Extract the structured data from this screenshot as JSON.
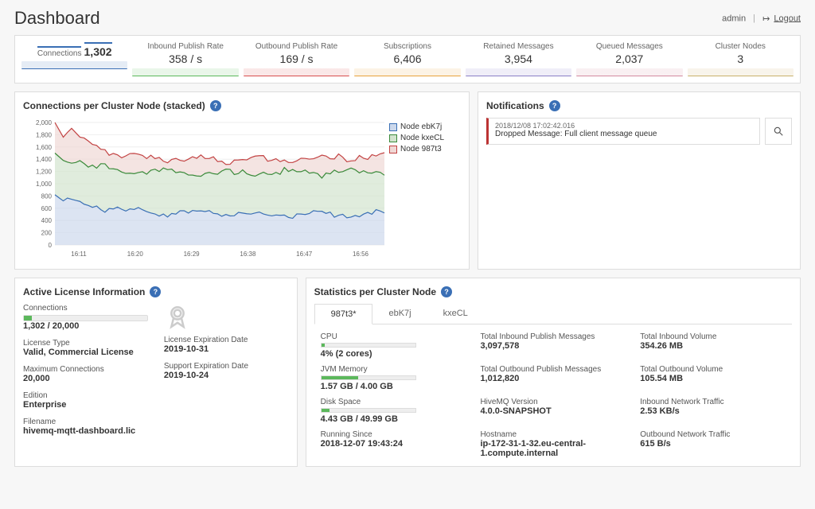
{
  "header": {
    "title": "Dashboard",
    "user": "admin",
    "logout": "Logout"
  },
  "kpis": [
    {
      "label": "Connections",
      "value": "1,302",
      "color": "#3a6fb5",
      "active": true
    },
    {
      "label": "Inbound Publish Rate",
      "value": "358 / s",
      "color": "#5cb85c"
    },
    {
      "label": "Outbound Publish Rate",
      "value": "169 / s",
      "color": "#d94e4e"
    },
    {
      "label": "Subscriptions",
      "value": "6,406",
      "color": "#e8a33d"
    },
    {
      "label": "Retained Messages",
      "value": "3,954",
      "color": "#8a7fc7"
    },
    {
      "label": "Queued Messages",
      "value": "2,037",
      "color": "#d48aa0"
    },
    {
      "label": "Cluster Nodes",
      "value": "3",
      "color": "#c9b06a"
    }
  ],
  "chart": {
    "title": "Connections per Cluster Node (stacked)",
    "yaxis": {
      "min": 0,
      "max": 2000,
      "step": 200,
      "labels": [
        "0",
        "200",
        "400",
        "600",
        "800",
        "1,000",
        "1,200",
        "1,400",
        "1,600",
        "1,800",
        "2,000"
      ]
    },
    "xaxis": [
      "16:11",
      "16:20",
      "16:29",
      "16:38",
      "16:47",
      "16:56"
    ],
    "legend": [
      {
        "name": "Node ebK7j",
        "color": "#3a6fb5",
        "fill": "#cdd9ec"
      },
      {
        "name": "Node kxeCL",
        "color": "#3a8a3a",
        "fill": "#d3e4ce"
      },
      {
        "name": "Node 987t3",
        "color": "#c24242",
        "fill": "#f0d8d5"
      }
    ]
  },
  "chart_data": {
    "type": "area",
    "title": "Connections per Cluster Node (stacked)",
    "xlabel": "",
    "ylabel": "",
    "ylim": [
      0,
      2000
    ],
    "x": [
      "16:11",
      "16:20",
      "16:29",
      "16:38",
      "16:47",
      "16:56"
    ],
    "series": [
      {
        "name": "Node ebK7j",
        "color": "#3a6fb5",
        "values_cumulative": [
          800,
          600,
          580,
          560,
          570,
          560
        ],
        "note": "bottom band top edge ≈ value"
      },
      {
        "name": "Node kxeCL",
        "color": "#3a8a3a",
        "values_cumulative": [
          1500,
          1250,
          1230,
          1220,
          1230,
          1250
        ]
      },
      {
        "name": "Node 987t3",
        "color": "#c24242",
        "values_cumulative": [
          2000,
          1500,
          1450,
          1430,
          1440,
          1500
        ]
      }
    ]
  },
  "notifications": {
    "title": "Notifications",
    "items": [
      {
        "ts": "2018/12/08 17:02:42.016",
        "msg": "Dropped Message: Full client message queue"
      }
    ]
  },
  "license": {
    "title": "Active License Information",
    "connections": {
      "label": "Connections",
      "value": "1,302 / 20,000",
      "pct": 6.5
    },
    "type": {
      "label": "License Type",
      "value": "Valid, Commercial License"
    },
    "max": {
      "label": "Maximum Connections",
      "value": "20,000"
    },
    "edition": {
      "label": "Edition",
      "value": "Enterprise"
    },
    "filename": {
      "label": "Filename",
      "value": "hivemq-mqtt-dashboard.lic"
    },
    "exp": {
      "label": "License Expiration Date",
      "value": "2019-10-31"
    },
    "support": {
      "label": "Support Expiration Date",
      "value": "2019-10-24"
    }
  },
  "stats": {
    "title": "Statistics per Cluster Node",
    "tabs": [
      "987t3*",
      "ebK7j",
      "kxeCL"
    ],
    "activeTab": 0,
    "cpu": {
      "label": "CPU",
      "value": "4% (2 cores)",
      "pct": 4
    },
    "jvm": {
      "label": "JVM Memory",
      "value": "1.57 GB / 4.00 GB",
      "pct": 39
    },
    "disk": {
      "label": "Disk Space",
      "value": "4.43 GB / 49.99 GB",
      "pct": 9
    },
    "running": {
      "label": "Running Since",
      "value": "2018-12-07 19:43:24"
    },
    "inMsg": {
      "label": "Total Inbound Publish Messages",
      "value": "3,097,578"
    },
    "outMsg": {
      "label": "Total Outbound Publish Messages",
      "value": "1,012,820"
    },
    "version": {
      "label": "HiveMQ Version",
      "value": "4.0.0-SNAPSHOT"
    },
    "hostname": {
      "label": "Hostname",
      "value": "ip-172-31-1-32.eu-central-1.compute.internal"
    },
    "inVol": {
      "label": "Total Inbound Volume",
      "value": "354.26 MB"
    },
    "outVol": {
      "label": "Total Outbound Volume",
      "value": "105.54 MB"
    },
    "inNet": {
      "label": "Inbound Network Traffic",
      "value": "2.53 KB/s"
    },
    "outNet": {
      "label": "Outbound Network Traffic",
      "value": "615 B/s"
    }
  }
}
